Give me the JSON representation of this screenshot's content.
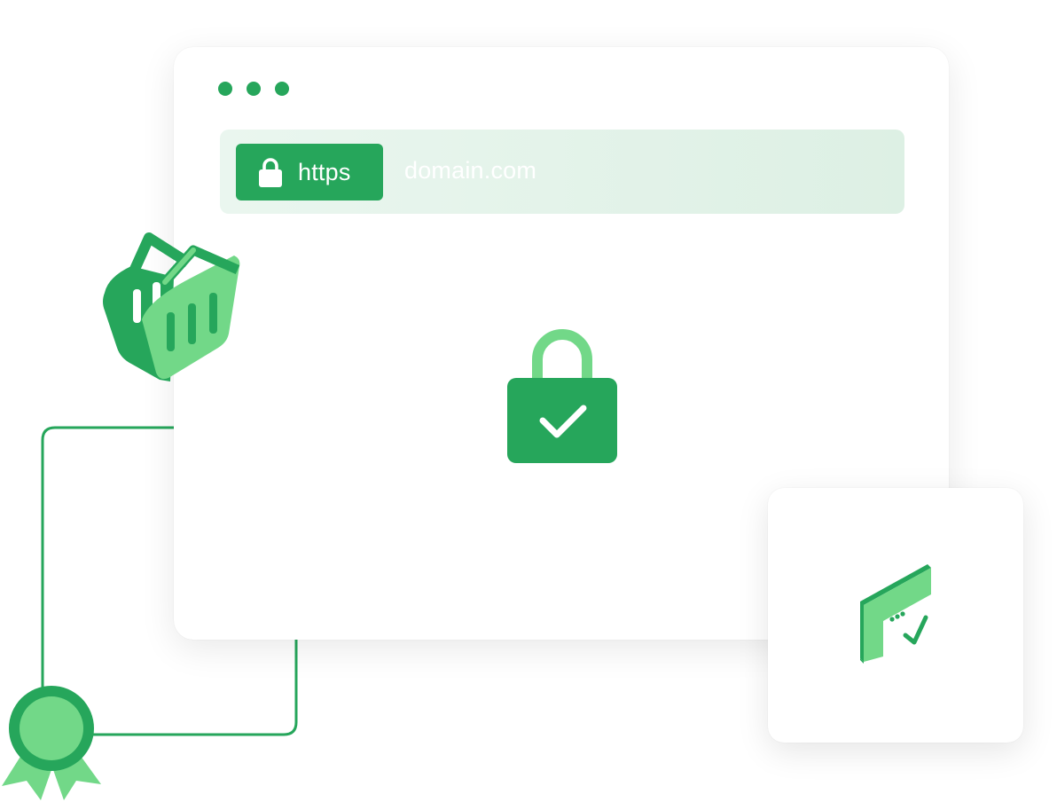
{
  "address_bar": {
    "protocol_label": "https",
    "domain": "domain.com",
    "lock_icon": "lock-icon"
  },
  "window_controls": [
    "dot",
    "dot",
    "dot"
  ],
  "center_icon": "lock-check-icon",
  "card_icon": "certificate-window-check-icon",
  "decorations": [
    "shopping-basket-icon",
    "award-ribbon-icon"
  ],
  "colors": {
    "primary_green": "#26a65b",
    "light_green": "#72d888",
    "address_bar_bg": "#e6f4ec"
  }
}
